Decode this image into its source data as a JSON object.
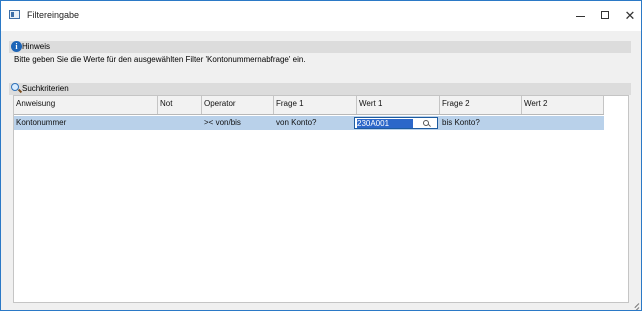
{
  "window": {
    "title": "Filtereingabe",
    "minimize_label": "",
    "maximize_label": "",
    "close_label": "✕"
  },
  "hinweis": {
    "label": "Hinweis",
    "text": "Bitte geben Sie die Werte für den ausgewählten Filter 'Kontonummernabfrage' ein."
  },
  "suchkriterien": {
    "label": "Suchkriterien",
    "columns": [
      "Anweisung",
      "Not",
      "Operator",
      "Frage 1",
      "Wert 1",
      "Frage 2",
      "Wert 2"
    ],
    "rows": [
      {
        "anweisung": "Kontonummer",
        "not": "",
        "operator": "><  von/bis",
        "frage1": "von Konto?",
        "wert1": "230A001",
        "frage2": "bis Konto?",
        "wert2": ""
      }
    ]
  },
  "icons": {
    "app": "window-icon",
    "hinweis": "info-icon",
    "suchkriterien": "search-icon",
    "editor": "search-icon",
    "resize": "resize-grip-icon"
  },
  "colors": {
    "window_border": "#2b79c6",
    "section_background": "#dcdcdc",
    "selected_row": "#b9d1ea",
    "selected_text": "#2c67c9",
    "info_icon": "#1d65b7"
  }
}
